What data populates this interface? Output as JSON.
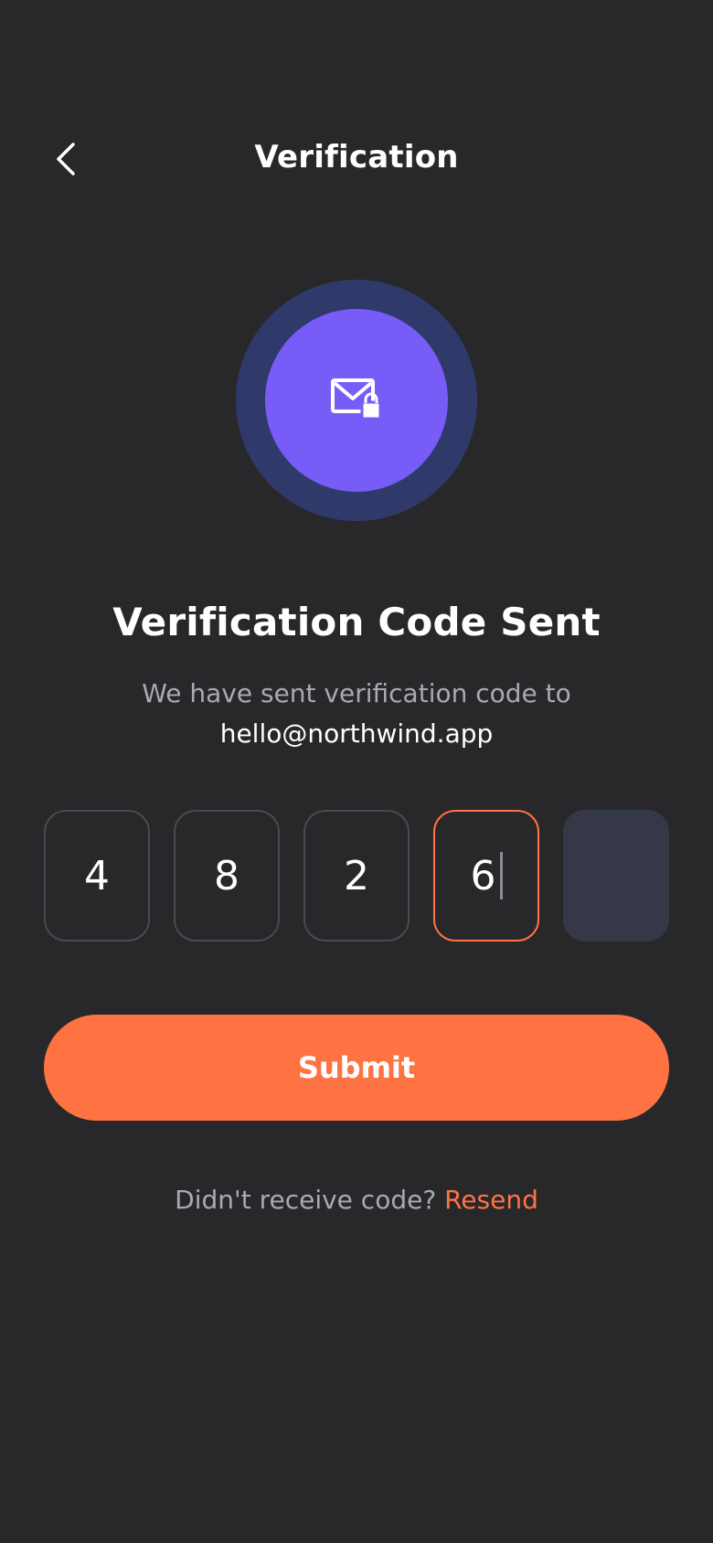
{
  "header": {
    "title": "Verification",
    "back_icon": "chevron-left-icon"
  },
  "badge": {
    "icon": "mail-lock-icon",
    "outer_color": "#2f3a6b",
    "inner_color": "#775cf7"
  },
  "content": {
    "title": "Verification Code Sent",
    "subtitle": "We have sent verification code to",
    "email": "hello@northwind.app"
  },
  "otp": {
    "digits": [
      "4",
      "8",
      "2",
      "6",
      ""
    ],
    "active_index": 3
  },
  "submit": {
    "label": "Submit"
  },
  "resend": {
    "prompt": "Didn't receive code?",
    "link_label": "Resend"
  },
  "colors": {
    "background": "#28282a",
    "accent": "#ff7342",
    "muted_text": "#a9a9b3"
  }
}
